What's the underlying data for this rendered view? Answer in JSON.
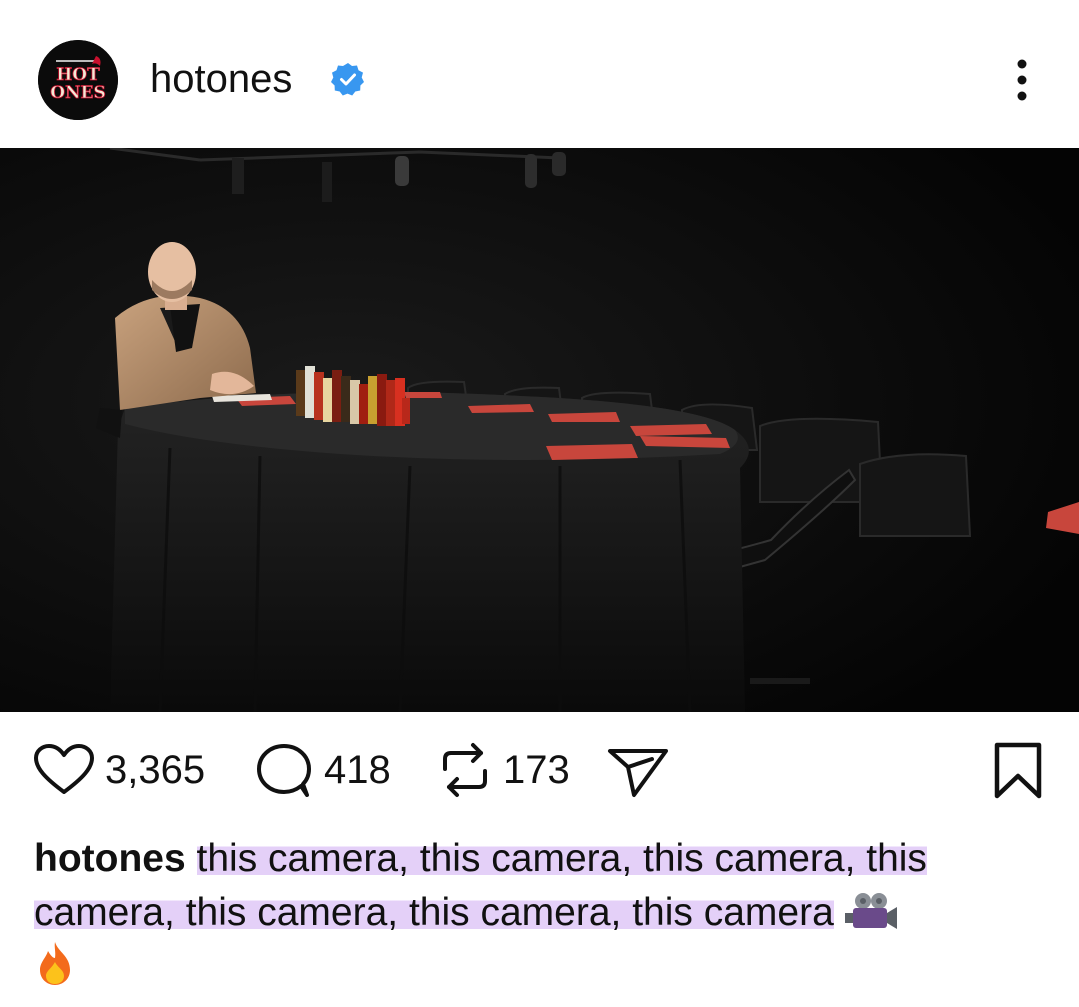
{
  "post": {
    "username": "hotones",
    "verified": true,
    "avatar": {
      "logo_line1": "HOT",
      "logo_line2": "ONES",
      "icon": "hot-ones-logo"
    },
    "more_icon": "more-vertical-icon"
  },
  "stats": {
    "likes": "3,365",
    "comments": "418",
    "reposts": "173"
  },
  "icons": {
    "like": "heart-icon",
    "comment": "comment-bubble-icon",
    "repost": "repost-icon",
    "share": "send-icon",
    "save": "bookmark-icon"
  },
  "caption": {
    "author": "hotones",
    "text": "this camera, this camera, this camera, this camera, this camera, this camera, this camera",
    "emojis": [
      "movie-camera-icon",
      "fire-icon"
    ]
  },
  "colors": {
    "verified_blue": "#3897f0",
    "highlight": "#c496f0",
    "text": "#111111"
  }
}
